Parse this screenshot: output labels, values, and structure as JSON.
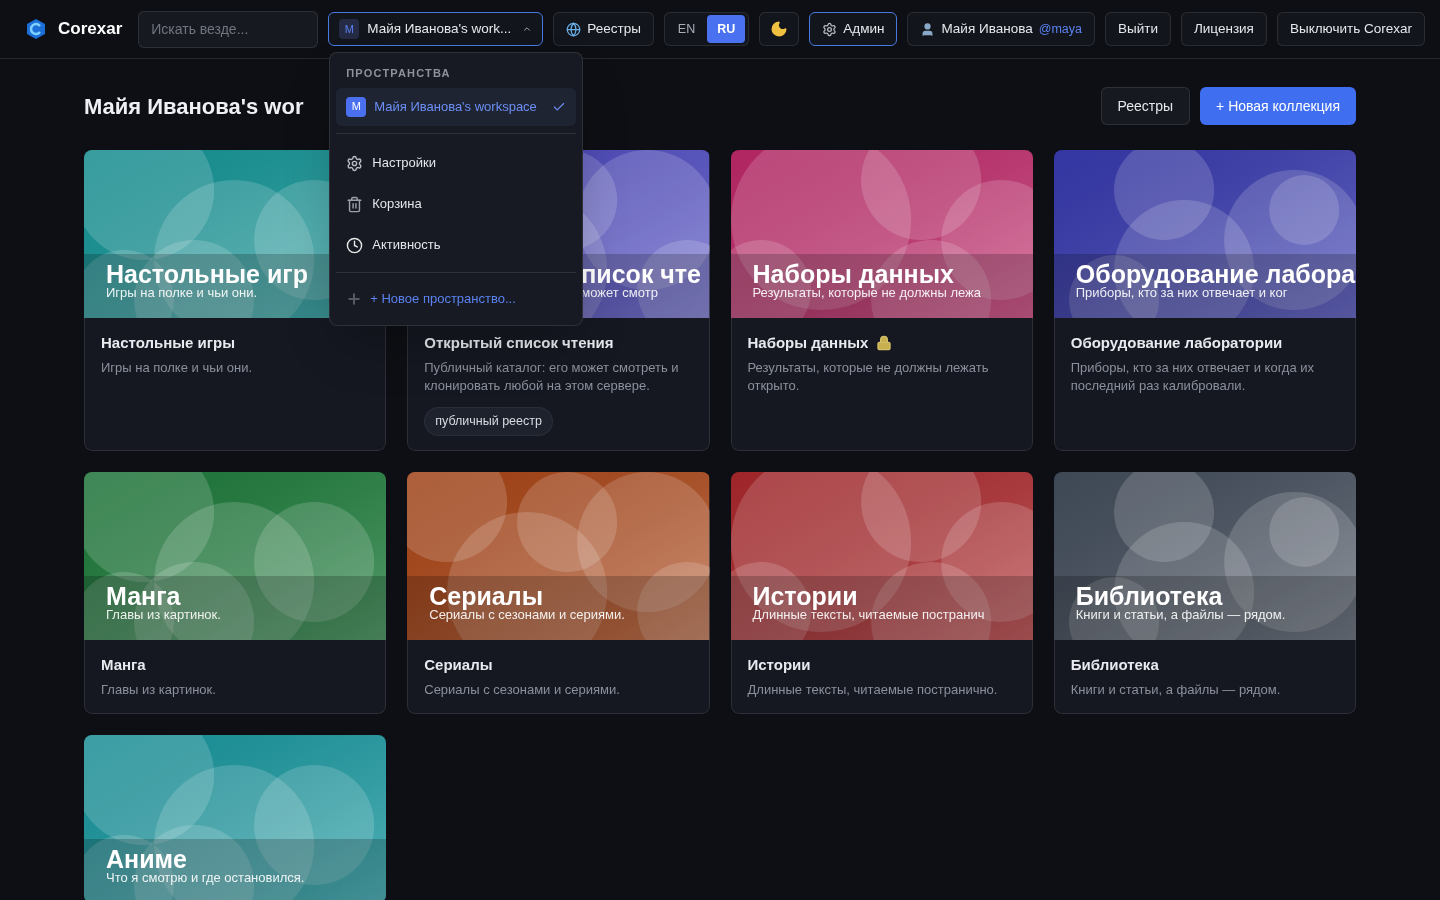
{
  "header": {
    "brand": "Corexar",
    "search": {
      "placeholder": "Искать везде..."
    },
    "workspace_select": {
      "avatar": "M",
      "label": "Майя Иванова's work...",
      "expanded": true
    },
    "registries_button": "Реестры",
    "languages": [
      {
        "label": "EN",
        "selected": false
      },
      {
        "label": "RU",
        "selected": true
      }
    ],
    "admin_button": {
      "label": "Админ",
      "selected": true
    },
    "user": {
      "name": "Майя Иванова",
      "handle": "@maya"
    },
    "buttons": [
      "Выйти",
      "Лицензия",
      "Выключить Corexar"
    ]
  },
  "workspace_menu": {
    "heading": "ПРОСТРАНСТВА",
    "workspaces": [
      {
        "avatar": "M",
        "label": "Майя Иванова's workspace",
        "selected": true
      }
    ],
    "items": [
      {
        "kind": "settings",
        "label": "Настройки"
      },
      {
        "kind": "trash",
        "label": "Корзина"
      },
      {
        "kind": "activity",
        "label": "Активность"
      }
    ],
    "new_workspace": "+ Новое пространство..."
  },
  "page": {
    "title": "Майя Иванова's wor",
    "buttons": [
      {
        "kind": "secondary",
        "label": "Реестры"
      },
      {
        "kind": "primary",
        "label": "+ Новая коллекция"
      }
    ]
  },
  "collections": [
    {
      "color": "#159a9c",
      "banner_title": "Настольные игр",
      "banner_subtitle": "Игры на полке и чьи они.",
      "name": "Настольные игры",
      "description": "Игры на полке и чьи они.",
      "locked": false
    },
    {
      "color": "#4f4bc6",
      "banner_title": "писок чте",
      "banner_subtitle": "может смотр",
      "name": "Открытый список чтения",
      "description": "Публичный каталог: его может смотреть и клонировать любой на этом сервере.",
      "tag": "публичный реестр",
      "locked": false
    },
    {
      "color": "#c42a6c",
      "banner_title": "Наборы данных",
      "banner_subtitle": "Результаты, которые не должны лежа",
      "name": "Наборы данных",
      "description": "Результаты, которые не должны лежать открыто.",
      "locked": true
    },
    {
      "color": "#3a3cb4",
      "banner_title": "Оборудование лабора",
      "banner_subtitle": "Приборы, кто за них отвечает и ког",
      "name": "Оборудование лаборатории",
      "description": "Приборы, кто за них отвечает и когда их последний раз калибровали.",
      "locked": false
    },
    {
      "color": "#1e7e3c",
      "banner_title": "Манга",
      "banner_subtitle": "Главы из картинок.",
      "name": "Манга",
      "description": "Главы из картинок.",
      "locked": false
    },
    {
      "color": "#b04818",
      "banner_title": "Сериалы",
      "banner_subtitle": "Сериалы с сезонами и сериями.",
      "name": "Сериалы",
      "description": "Сериалы с сезонами и сериями.",
      "locked": false
    },
    {
      "color": "#b02a2e",
      "banner_title": "Истории",
      "banner_subtitle": "Длинные тексты, читаемые постранич",
      "name": "Истории",
      "description": "Длинные тексты, читаемые постранично.",
      "locked": false
    },
    {
      "color": "#46505f",
      "banner_title": "Библиотека",
      "banner_subtitle": "Книги и статьи, а файлы — рядом.",
      "name": "Библиотека",
      "description": "Книги и статьи, а файлы — рядом.",
      "locked": false
    },
    {
      "color": "#1a9ca4",
      "banner_title": "Аниме",
      "banner_subtitle": "Что я смотрю и где остановился."
    }
  ]
}
